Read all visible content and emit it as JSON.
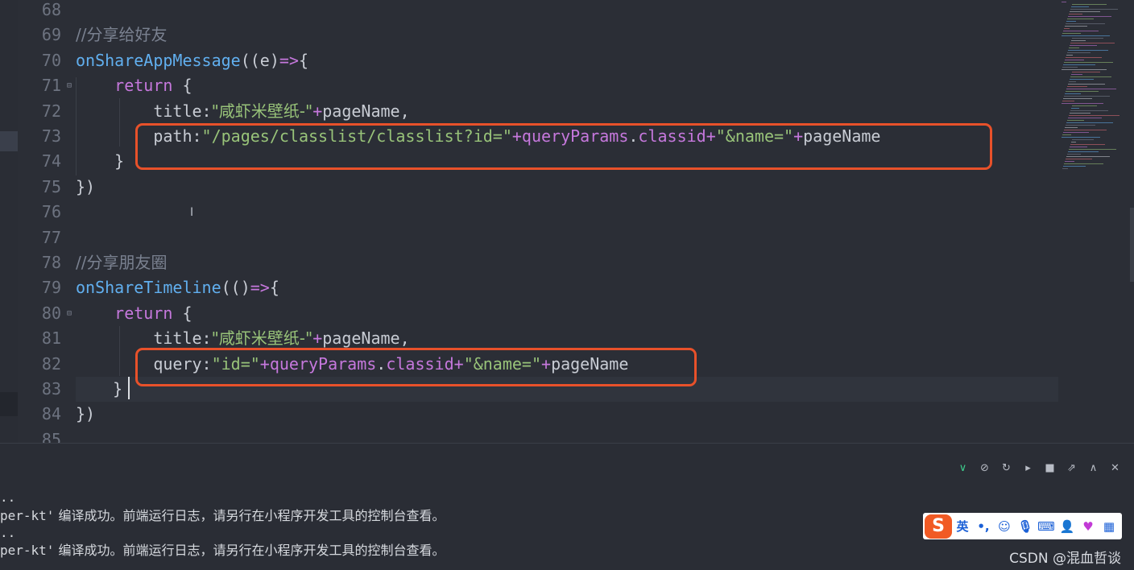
{
  "editor": {
    "lines": [
      {
        "n": "68",
        "tokens": []
      },
      {
        "n": "69",
        "tokens": [
          {
            "t": "//分享给好友",
            "c": "cmt cjk"
          }
        ]
      },
      {
        "n": "70",
        "tokens": [
          {
            "t": "onShareAppMessage",
            "c": "fn"
          },
          {
            "t": "((e)",
            "c": "txt"
          },
          {
            "t": "=>",
            "c": "op"
          },
          {
            "t": "{",
            "c": "txt"
          }
        ]
      },
      {
        "n": "71",
        "fold": true,
        "tokens": [
          {
            "t": "    ",
            "c": "txt"
          },
          {
            "t": "return",
            "c": "kw"
          },
          {
            "t": " {",
            "c": "txt"
          }
        ]
      },
      {
        "n": "72",
        "tokens": [
          {
            "t": "        title:",
            "c": "txt"
          },
          {
            "t": "\"咸虾米壁纸-\"",
            "c": "str cjk"
          },
          {
            "t": "+",
            "c": "op"
          },
          {
            "t": "pageName,",
            "c": "txt"
          }
        ]
      },
      {
        "n": "73",
        "tokens": [
          {
            "t": "        path:",
            "c": "txt"
          },
          {
            "t": "\"/pages/classlist/classlist?id=\"",
            "c": "str"
          },
          {
            "t": "+",
            "c": "op"
          },
          {
            "t": "queryParams",
            "c": "kw"
          },
          {
            "t": ".",
            "c": "txt"
          },
          {
            "t": "classid",
            "c": "kw"
          },
          {
            "t": "+",
            "c": "op"
          },
          {
            "t": "\"&name=\"",
            "c": "str"
          },
          {
            "t": "+",
            "c": "op"
          },
          {
            "t": "pageName",
            "c": "txt"
          }
        ]
      },
      {
        "n": "74",
        "tokens": [
          {
            "t": "    }",
            "c": "txt"
          }
        ]
      },
      {
        "n": "75",
        "tokens": [
          {
            "t": "})",
            "c": "txt"
          }
        ]
      },
      {
        "n": "76",
        "tokens": []
      },
      {
        "n": "77",
        "tokens": []
      },
      {
        "n": "78",
        "tokens": [
          {
            "t": "//分享朋友圈",
            "c": "cmt cjk"
          }
        ]
      },
      {
        "n": "79",
        "tokens": [
          {
            "t": "onShareTimeline",
            "c": "fn"
          },
          {
            "t": "(()",
            "c": "txt"
          },
          {
            "t": "=>",
            "c": "op"
          },
          {
            "t": "{",
            "c": "txt"
          }
        ]
      },
      {
        "n": "80",
        "fold": true,
        "tokens": [
          {
            "t": "    ",
            "c": "txt"
          },
          {
            "t": "return",
            "c": "kw"
          },
          {
            "t": " {",
            "c": "txt"
          }
        ]
      },
      {
        "n": "81",
        "tokens": [
          {
            "t": "        title:",
            "c": "txt"
          },
          {
            "t": "\"咸虾米壁纸-\"",
            "c": "str cjk"
          },
          {
            "t": "+",
            "c": "op"
          },
          {
            "t": "pageName,",
            "c": "txt"
          }
        ]
      },
      {
        "n": "82",
        "tokens": [
          {
            "t": "        query:",
            "c": "txt"
          },
          {
            "t": "\"id=\"",
            "c": "str"
          },
          {
            "t": "+",
            "c": "op"
          },
          {
            "t": "queryParams",
            "c": "kw"
          },
          {
            "t": ".",
            "c": "txt"
          },
          {
            "t": "classid",
            "c": "kw"
          },
          {
            "t": "+",
            "c": "op"
          },
          {
            "t": "\"&name=\"",
            "c": "str"
          },
          {
            "t": "+",
            "c": "op"
          },
          {
            "t": "pageName",
            "c": "txt"
          }
        ]
      },
      {
        "n": "83",
        "current": true,
        "tokens": [
          {
            "t": "    }",
            "c": "txt"
          }
        ]
      },
      {
        "n": "84",
        "tokens": [
          {
            "t": "})",
            "c": "txt"
          }
        ]
      },
      {
        "n": "85",
        "tokens": []
      }
    ],
    "highlight_color": "#e8512a"
  },
  "toolbar": {
    "icons": [
      "chevron-down-icon",
      "clear-log-icon",
      "restart-icon",
      "play-circle-icon",
      "stop-icon",
      "open-external-icon",
      "chevron-up-icon",
      "close-panel-icon"
    ]
  },
  "console": {
    "lines": [
      {
        "prefix": "..",
        "msg": ""
      },
      {
        "prefix": "per-kt'",
        "msg": " 编译成功。前端运行日志，请另行在小程序开发工具的控制台查看。"
      },
      {
        "prefix": "..",
        "msg": ""
      },
      {
        "prefix": "per-kt'",
        "msg": " 编译成功。前端运行日志，请另行在小程序开发工具的控制台查看。"
      }
    ]
  },
  "ime": {
    "logo": "S",
    "mode": "英",
    "icons": [
      "punctuation-icon",
      "emoji-icon",
      "microphone-icon",
      "keyboard-icon",
      "user-icon",
      "skin-icon",
      "apps-icon"
    ]
  },
  "watermark": "CSDN @混血哲谈"
}
